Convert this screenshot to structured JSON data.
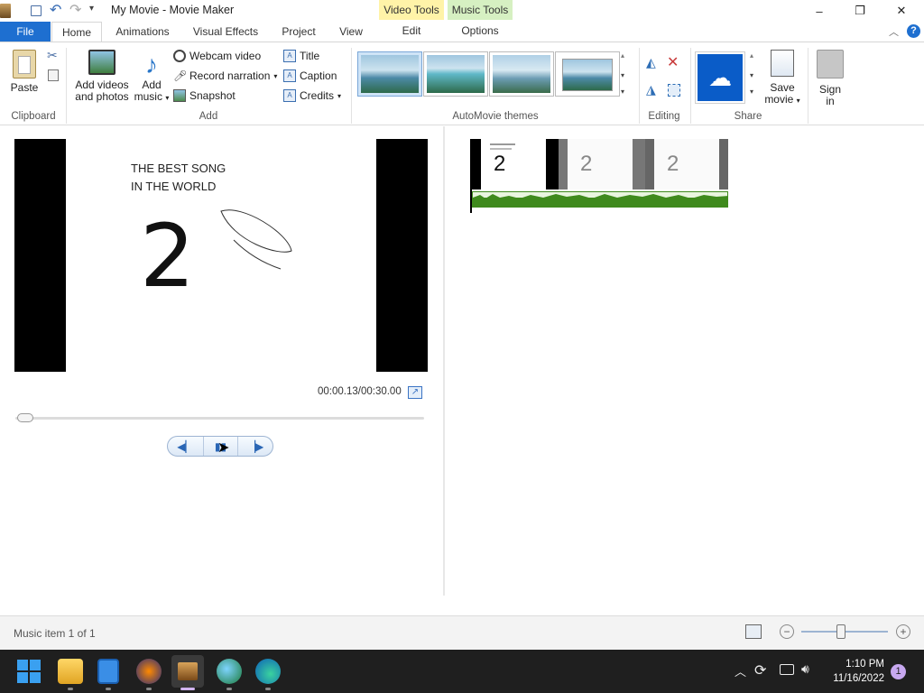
{
  "window": {
    "title": "My Movie - Movie Maker",
    "controls": {
      "minimize": "–",
      "maximize": "❐",
      "close": "✕"
    }
  },
  "context_tabs": {
    "video_tools": {
      "header": "Video Tools",
      "tab": "Edit",
      "color": "#fff3a8"
    },
    "music_tools": {
      "header": "Music Tools",
      "tab": "Options",
      "color": "#d6f0c2"
    }
  },
  "tabs": [
    "File",
    "Home",
    "Animations",
    "Visual Effects",
    "Project",
    "View"
  ],
  "active_tab": "Home",
  "ribbon": {
    "clipboard": {
      "label": "Clipboard",
      "paste": "Paste"
    },
    "add": {
      "label": "Add",
      "add_videos_line1": "Add videos",
      "add_videos_line2": "and photos",
      "add_music_line1": "Add",
      "add_music_line2": "music",
      "webcam": "Webcam video",
      "record": "Record narration",
      "snapshot": "Snapshot",
      "title": "Title",
      "caption": "Caption",
      "credits": "Credits"
    },
    "themes": {
      "label": "AutoMovie themes"
    },
    "editing": {
      "label": "Editing"
    },
    "share": {
      "label": "Share",
      "save_line1": "Save",
      "save_line2": "movie",
      "sign_line1": "Sign",
      "sign_line2": "in"
    }
  },
  "preview": {
    "line1": "THE BEST SONG",
    "line2": "IN THE WORLD",
    "number": "2",
    "time": "00:00.13/00:30.00",
    "progress": 0.005
  },
  "timeline": {
    "thumb_number": "2"
  },
  "status": {
    "text": "Music item 1 of 1",
    "zoom_level": 0.45
  },
  "clock": {
    "time": "1:10 PM",
    "date": "11/16/2022"
  },
  "notification_count": "1",
  "colors": {
    "accent": "#1e6fd0",
    "onedrive": "#0a5cc8",
    "waveform": "#3f8a1d"
  }
}
